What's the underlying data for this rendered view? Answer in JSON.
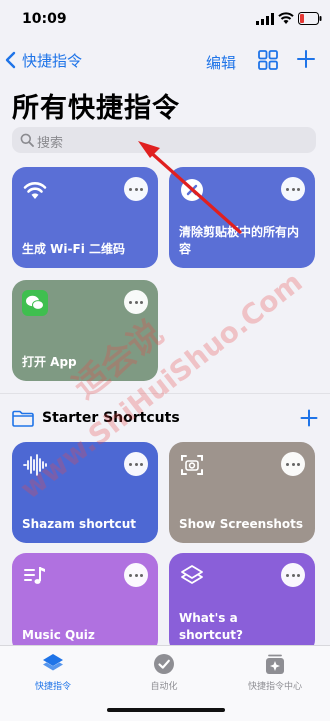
{
  "status_bar": {
    "time": "10:09"
  },
  "nav": {
    "back_label": "快捷指令",
    "edit_label": "编辑"
  },
  "page_title": "所有快捷指令",
  "search": {
    "placeholder": "搜索"
  },
  "shortcuts": [
    {
      "label": "生成 Wi-Fi 二维码",
      "color": "#5a6fd6"
    },
    {
      "label": "清除剪贴板中的所有内容",
      "color": "#5a6fd6"
    },
    {
      "label": "打开 App",
      "color": "#7f9a83"
    }
  ],
  "starter_section": {
    "title": "Starter Shortcuts"
  },
  "starter_shortcuts": [
    {
      "label": "Shazam shortcut",
      "color": "#4d68d3"
    },
    {
      "label": "Show Screenshots",
      "color": "#9e948d"
    },
    {
      "label": "Music Quiz",
      "color": "#b071e0"
    },
    {
      "label": "What's a shortcut?",
      "color": "#8a5fd9"
    }
  ],
  "tabs": [
    {
      "label": "快捷指令",
      "active": true
    },
    {
      "label": "自动化",
      "active": false
    },
    {
      "label": "快捷指令中心",
      "active": false
    }
  ],
  "watermark": {
    "cn": "适会说",
    "url": "www.ShiHuiShuo.Com"
  },
  "colors": {
    "accent": "#1f74e8",
    "arrow": "#e02020"
  }
}
